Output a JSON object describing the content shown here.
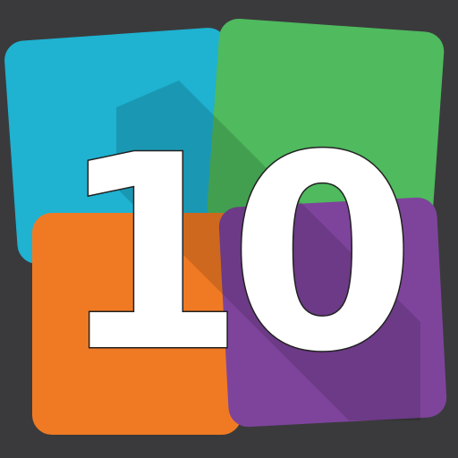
{
  "icon": {
    "number": "10",
    "colors": {
      "background": "#3a3a3c",
      "blue_tile": "#1fb2d1",
      "green_tile": "#4fba5e",
      "orange_tile": "#f07a24",
      "purple_tile": "#7e449c",
      "number_fill": "#ffffff",
      "number_outline": "#222222"
    }
  }
}
